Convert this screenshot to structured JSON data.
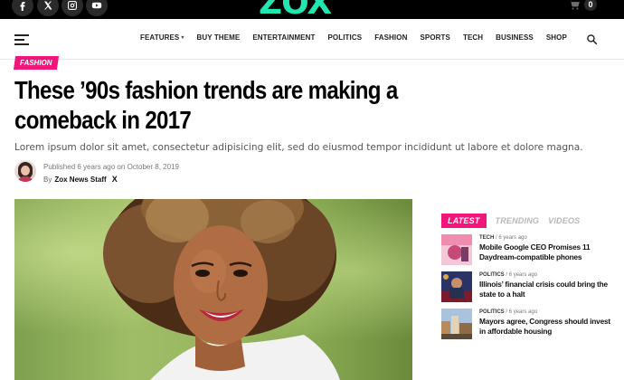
{
  "topbar": {
    "social": [
      {
        "name": "facebook",
        "glyph": "f"
      },
      {
        "name": "x",
        "glyph": "X"
      },
      {
        "name": "instagram",
        "glyph": "ig"
      },
      {
        "name": "youtube",
        "glyph": "yt"
      }
    ],
    "logo": "ZOX",
    "cart_count": "0",
    "accent": "#22e6b0"
  },
  "nav": {
    "items": [
      "FEATURES",
      "BUY THEME",
      "ENTERTAINMENT",
      "POLITICS",
      "FASHION",
      "SPORTS",
      "TECH",
      "BUSINESS",
      "SHOP"
    ]
  },
  "article": {
    "category": "FASHION",
    "title": "These ’90s fashion trends are making a comeback in 2017",
    "excerpt": "Lorem ipsum dolor sit amet, consectetur adipisicing elit, sed do eiusmod tempor incididunt ut labore et dolore magna.",
    "published_prefix": "Published",
    "published_ago": "6 years ago",
    "published_on": "on",
    "published_date": "October 8, 2019",
    "by": "By",
    "author": "Zox News Staff",
    "author_social": "X",
    "accent": "#f0167a"
  },
  "sidebar": {
    "tabs": [
      "LATEST",
      "TRENDING",
      "VIDEOS"
    ],
    "posts": [
      {
        "category": "TECH",
        "ago": "6 years ago",
        "title": "Mobile Google CEO Promises 11 Daydream-compatible phones"
      },
      {
        "category": "POLITICS",
        "ago": "6 years ago",
        "title": "Illinois’ financial crisis could bring the state to a halt"
      },
      {
        "category": "POLITICS",
        "ago": "6 years ago",
        "title": "Mayors agree, Congress should invest in affordable housing"
      }
    ]
  }
}
